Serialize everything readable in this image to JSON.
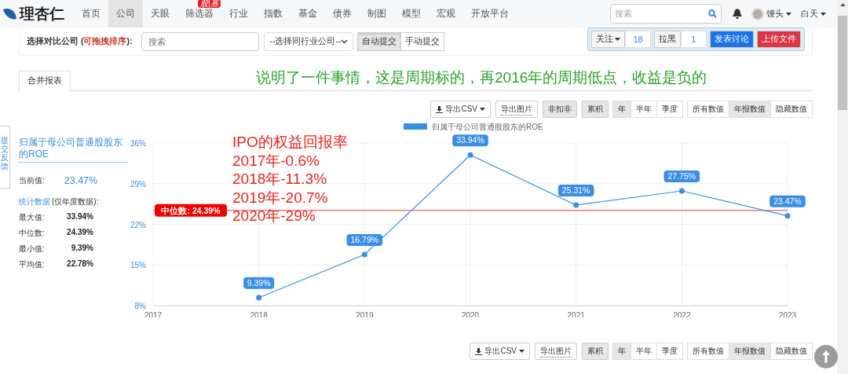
{
  "nav": {
    "logo": "理杏仁",
    "items": [
      {
        "label": "首页",
        "selected": false
      },
      {
        "label": "公司",
        "selected": true
      },
      {
        "label": "天眼",
        "selected": false
      },
      {
        "label": "筛选器",
        "selected": false,
        "badge": "股|基"
      },
      {
        "label": "行业",
        "selected": false
      },
      {
        "label": "指数",
        "selected": false
      },
      {
        "label": "基金",
        "selected": false
      },
      {
        "label": "债券",
        "selected": false
      },
      {
        "label": "制图",
        "selected": false
      },
      {
        "label": "模型",
        "selected": false
      },
      {
        "label": "宏观",
        "selected": false
      },
      {
        "label": "开放平台",
        "selected": false
      }
    ],
    "search_placeholder": "搜索",
    "user": "馒头",
    "theme": "白天"
  },
  "compare": {
    "label_before": "选择对比公司 (",
    "label_hint": "可拖拽排序",
    "label_after": "):",
    "search_placeholder": "搜索",
    "select": "--选择同行业公司--",
    "modes": [
      {
        "label": "自动提交",
        "selected": true
      },
      {
        "label": "手动提交",
        "selected": false
      }
    ]
  },
  "actions": {
    "follow": "关注",
    "follow_count": "18",
    "block": "拉黑",
    "block_count": "1",
    "discuss": "发表讨论",
    "upload": "上传文件"
  },
  "tabs": [
    {
      "label": "合并报表",
      "selected": true
    }
  ],
  "annotation_green": "说明了一件事情，这是周期标的，再2016年的周期低点，收益是负的",
  "annotation_red": [
    "IPO的权益回报率",
    "2017年-0.6%",
    "2018年-11.3%",
    "2019年-20.7%",
    "2020年-29%"
  ],
  "feedback_tab": "提交反馈",
  "metric": {
    "title": "归属于母公司普通股股东的ROE",
    "current_label": "当前值:",
    "current_value": "23.47%",
    "stats_title": "统计数据",
    "stats_note": "(仅年度数据):",
    "stats": [
      {
        "label": "最大值:",
        "value": "33.94%"
      },
      {
        "label": "中位数:",
        "value": "24.39%"
      },
      {
        "label": "最小值:",
        "value": "9.39%"
      },
      {
        "label": "平均值:",
        "value": "22.78%"
      }
    ]
  },
  "toolbar": {
    "export_csv": "导出CSV",
    "export_image": "导出图片",
    "toggles": [
      {
        "label": "非扣非",
        "selected": true
      },
      {
        "label": "累积",
        "selected": true
      }
    ],
    "periods": [
      {
        "label": "年",
        "selected": true
      },
      {
        "label": "半年",
        "selected": false
      },
      {
        "label": "季度",
        "selected": false
      }
    ],
    "value_modes": [
      {
        "label": "所有数值",
        "selected": false
      },
      {
        "label": "年报数值",
        "selected": true
      },
      {
        "label": "隐藏数值",
        "selected": false
      }
    ]
  },
  "chart_data": {
    "type": "line",
    "categories": [
      "2017",
      "2018",
      "2019",
      "2020",
      "2021",
      "2022",
      "2023"
    ],
    "grid": true,
    "series": [
      {
        "name": "归属于母公司普通股股东的ROE",
        "color": "#3a8ee6",
        "marker": true,
        "values": [
          null,
          9.39,
          16.79,
          33.94,
          25.31,
          27.75,
          23.47
        ]
      }
    ],
    "ylim": [
      8,
      36
    ],
    "yticks": [
      {
        "value": 8,
        "label": "8%"
      },
      {
        "value": 15,
        "label": "15%"
      },
      {
        "value": 22,
        "label": "22%"
      },
      {
        "value": 29,
        "label": "29%"
      },
      {
        "value": 36,
        "label": "36%"
      }
    ],
    "value_labels": [
      "9.39%",
      "16.79%",
      "33.94%",
      "25.31%",
      "27.75%",
      "23.47%"
    ],
    "ref_lines": [
      {
        "axis": "y",
        "value": 24.39,
        "label": "中位数: 24.39%",
        "color": "#e53935"
      }
    ]
  },
  "bottom_toolbar": {
    "export_csv": "导出CSV",
    "export_image": "导出图片",
    "toggles": [
      {
        "label": "累积",
        "selected": true
      }
    ],
    "periods": [
      {
        "label": "年",
        "selected": true
      },
      {
        "label": "半年",
        "selected": false
      },
      {
        "label": "季度",
        "selected": false
      }
    ],
    "value_modes": [
      {
        "label": "所有数值",
        "selected": false
      },
      {
        "label": "年报数值",
        "selected": true
      },
      {
        "label": "隐藏数值",
        "selected": false
      }
    ]
  }
}
